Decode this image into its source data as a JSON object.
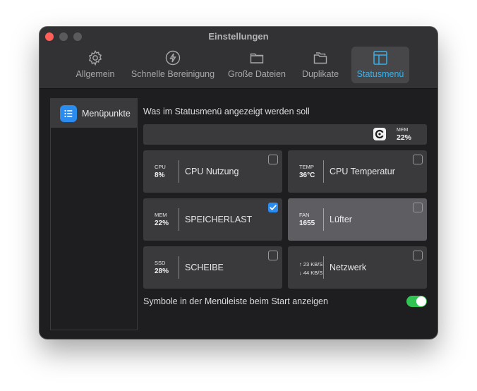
{
  "window": {
    "title": "Einstellungen"
  },
  "tabs": [
    {
      "label": "Allgemein",
      "icon": "gear-icon"
    },
    {
      "label": "Schnelle Bereinigung",
      "icon": "lightning-icon"
    },
    {
      "label": "Große Dateien",
      "icon": "folder-icon"
    },
    {
      "label": "Duplikate",
      "icon": "duplicate-folder-icon"
    },
    {
      "label": "Statusmenü",
      "icon": "window-layout-icon",
      "active": true
    }
  ],
  "sidebar": {
    "items": [
      {
        "label": "Menüpunkte",
        "icon": "list-icon",
        "selected": true
      }
    ]
  },
  "main": {
    "section_title": "Was im Statusmenü angezeigt werden soll",
    "preview": {
      "icon": "app-logo-icon",
      "label": "MEM",
      "value": "22%"
    },
    "cards": [
      {
        "short": "CPU",
        "value": "8%",
        "name": "CPU Nutzung",
        "checked": false
      },
      {
        "short": "TEMP",
        "value": "36°C",
        "name": "CPU Temperatur",
        "checked": false
      },
      {
        "short": "MEM",
        "value": "22%",
        "name": "SPEICHERLAST",
        "checked": true
      },
      {
        "short": "FAN",
        "value": "1655",
        "name": "Lüfter",
        "checked": false,
        "highlighted": true
      },
      {
        "short": "SSD",
        "value": "28%",
        "name": "SCHEIBE",
        "checked": false
      },
      {
        "up": "↑ 23 KB/S",
        "down": "↓ 44 KB/S",
        "name": "Netzwerk",
        "checked": false
      }
    ],
    "startup_label": "Symbole in der Menüleiste beim Start anzeigen",
    "startup_enabled": true
  },
  "colors": {
    "accent": "#3ab0e8",
    "checkbox_blue": "#2b8cf0",
    "toggle_green": "#31c452",
    "window_bg": "#1e1e20",
    "card_bg": "#3a3a3c"
  }
}
